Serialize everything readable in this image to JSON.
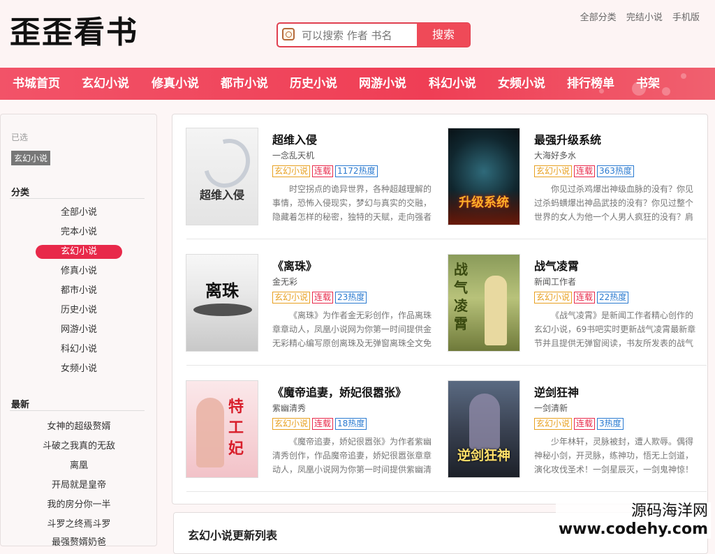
{
  "header": {
    "logo": "歪歪看书",
    "search_placeholder": "可以搜索 作者 书名",
    "search_button": "搜索",
    "top_links": [
      "全部分类",
      "完结小说",
      "手机版"
    ]
  },
  "nav": [
    "书城首页",
    "玄幻小说",
    "修真小说",
    "都市小说",
    "历史小说",
    "网游小说",
    "科幻小说",
    "女频小说",
    "排行榜单",
    "书架"
  ],
  "sidebar": {
    "selected_label": "已选",
    "selected_tag": "玄幻小说",
    "category_title": "分类",
    "categories": [
      "全部小说",
      "完本小说",
      "玄幻小说",
      "修真小说",
      "都市小说",
      "历史小说",
      "网游小说",
      "科幻小说",
      "女频小说"
    ],
    "latest_title": "最新",
    "latest": [
      "女神的超级赘婿",
      "斗破之我真的无敌",
      "离凰",
      "开局就是皇帝",
      "我的房分你一半",
      "斗罗之终焉斗罗",
      "最强赘婿奶爸"
    ]
  },
  "books": [
    {
      "title": "超维入侵",
      "cover_text": "超维入侵",
      "author": "一念乱天机",
      "tag_category": "玄幻小说",
      "tag_status": "连载",
      "tag_heat": "1172热度",
      "desc": "时空拐点的诡异世界，各种超越理解的事情，恐怖入侵现实，梦幻与真实的交融，隐藏着怎样的秘密，独特的天赋，走向强者之"
    },
    {
      "title": "最强升级系统",
      "cover_text": "升级系统",
      "author": "大海好多水",
      "tag_category": "玄幻小说",
      "tag_status": "连载",
      "tag_heat": "363热度",
      "desc": "你见过杀鸡爆出神级血脉的没有？你见过杀蚂蟥爆出神品武技的没有？你见过整个世界的女人为他一个人男人疯狂的没有？肩扛"
    },
    {
      "title": "《离珠》",
      "cover_text": "离珠",
      "author": "金无彩",
      "tag_category": "玄幻小说",
      "tag_status": "连载",
      "tag_heat": "23热度",
      "desc": "《离珠》为作者金无彩创作，作品离珠章章动人，凤凰小说网为你第一时间提供金无彩精心编写原创离珠及无弹窗离珠全文免费阅"
    },
    {
      "title": "战气凌霄",
      "cover_text": "战气凌霄",
      "author": "新闻工作者",
      "tag_category": "玄幻小说",
      "tag_status": "连载",
      "tag_heat": "22热度",
      "desc": "《战气凌霄》是新闻工作者精心创作的玄幻小说，69书吧实时更新战气凌霄最新章节并且提供无弹窗阅读，书友所发表的战气凌"
    },
    {
      "title": "《魔帝追妻，娇妃很嚣张》",
      "cover_text": "特工妃",
      "author": "紫幽清秀",
      "tag_category": "玄幻小说",
      "tag_status": "连载",
      "tag_heat": "18热度",
      "desc": "《魔帝追妻，娇妃很嚣张》为作者紫幽清秀创作，作品魔帝追妻，娇妃很嚣张章章动人，凤凰小说网为你第一时间提供紫幽清秀"
    },
    {
      "title": "逆剑狂神",
      "cover_text": "逆剑狂神",
      "author": "一剑清新",
      "tag_category": "玄幻小说",
      "tag_status": "连载",
      "tag_heat": "3热度",
      "desc": "少年林轩，灵脉被封，遭人欺辱。偶得神秘小剑，开灵脉，练神功，悟无上剑道，演化攻伐圣术！一剑星辰灭，一剑鬼神惊！一"
    }
  ],
  "section_title": "玄幻小说更新列表",
  "watermark": {
    "line1": "源码海洋网",
    "line2": "www.codehy.com"
  },
  "colors": {
    "accent": "#e8294a",
    "nav": "#ef3e55",
    "tag_category": "#e8a020",
    "tag_status": "#e8294a",
    "tag_heat": "#2a7ad0"
  }
}
